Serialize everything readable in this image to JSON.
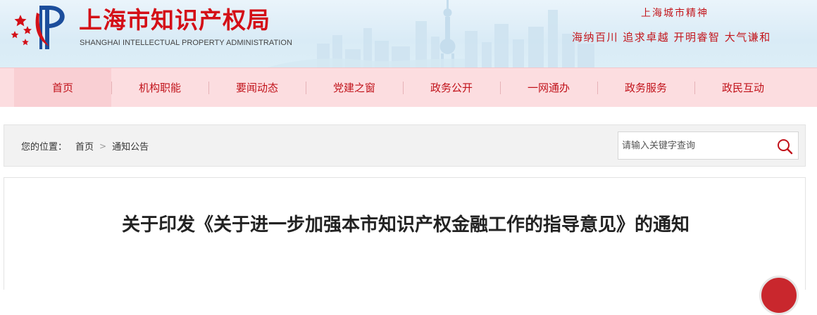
{
  "header": {
    "site_title": "上海市知识产权局",
    "site_subtitle": "SHANGHAI INTELLECTUAL PROPERTY ADMINISTRATION",
    "spirit_title": "上海城市精神",
    "spirit_text": "海纳百川 追求卓越 开明睿智 大气谦和",
    "logo_icon": "shanghai-ipa-logo",
    "brand_color": "#d40f17"
  },
  "nav": {
    "items": [
      {
        "label": "首页",
        "active": true
      },
      {
        "label": "机构职能"
      },
      {
        "label": "要闻动态"
      },
      {
        "label": "党建之窗"
      },
      {
        "label": "政务公开"
      },
      {
        "label": "一网通办"
      },
      {
        "label": "政务服务"
      },
      {
        "label": "政民互动"
      }
    ],
    "background": "#fcdde0",
    "text_color": "#c1121a"
  },
  "breadcrumb": {
    "label": "您的位置：",
    "items": [
      "首页",
      "通知公告"
    ],
    "separator": ">"
  },
  "search": {
    "placeholder": "请输入关键字查询",
    "icon": "search-icon"
  },
  "article": {
    "title": "关于印发《关于进一步加强本市知识产权金融工作的指导意见》的通知"
  }
}
